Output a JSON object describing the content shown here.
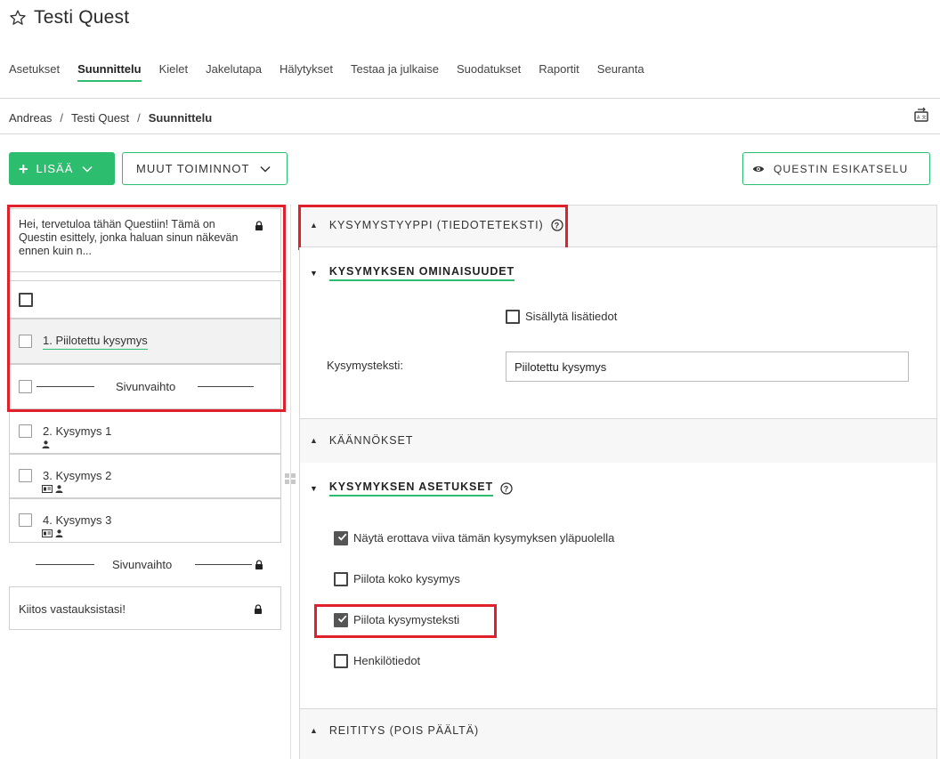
{
  "header": {
    "title": "Testi Quest",
    "star_icon": "star-outline-icon"
  },
  "nav": {
    "tabs": [
      {
        "label": "Asetukset",
        "active": false
      },
      {
        "label": "Suunnittelu",
        "active": true
      },
      {
        "label": "Kielet",
        "active": false
      },
      {
        "label": "Jakelutapa",
        "active": false
      },
      {
        "label": "Hälytykset",
        "active": false
      },
      {
        "label": "Testaa ja julkaise",
        "active": false
      },
      {
        "label": "Suodatukset",
        "active": false
      },
      {
        "label": "Raportit",
        "active": false
      },
      {
        "label": "Seuranta",
        "active": false
      }
    ]
  },
  "breadcrumb": {
    "items": [
      "Andreas",
      "Testi Quest",
      "Suunnittelu"
    ],
    "separator": "/"
  },
  "toolbar": {
    "add_label": "LISÄÄ",
    "more_label": "MUUT TOIMINNOT",
    "preview_label": "QUESTIN ESIKATSELU"
  },
  "question_list": {
    "intro_text": "Hei, tervetuloa tähän Questiin! Tämä on Questin esittely, jonka haluan sinun näkevän ennen kuin n...",
    "questions": [
      {
        "label": "1.  Piilotettu kysymys",
        "selected": true
      },
      {
        "label": "2.  Kysymys 1"
      },
      {
        "label": "3.  Kysymys 2"
      },
      {
        "label": "4.  Kysymys 3"
      }
    ],
    "page_break_label": "Sivunvaihto",
    "page_break_label_2": "Sivunvaihto",
    "outro_text": "Kiitos vastauksistasi!"
  },
  "panel": {
    "question_type": "KYSYMYSTYYPPI (TIEDOTETEKSTI)",
    "properties_header": "KYSYMYKSEN OMINAISUUDET",
    "include_extra_label": "Sisällytä lisätiedot",
    "include_extra_checked": false,
    "question_text_label": "Kysymysteksti:",
    "question_text_value": "Piilotettu kysymys",
    "translations_header": "KÄÄNNÖKSET",
    "settings_header": "KYSYMYKSEN ASETUKSET",
    "settings": [
      {
        "label": "Näytä erottava viiva tämän kysymyksen yläpuolella",
        "checked": true
      },
      {
        "label": "Piilota koko kysymys",
        "checked": false
      },
      {
        "label": "Piilota kysymysteksti",
        "checked": true
      },
      {
        "label": "Henkilötiedot",
        "checked": false
      }
    ],
    "routing_header": "REITITYS (POIS PÄÄLTÄ)"
  },
  "colors": {
    "accent": "#2dbd6e",
    "highlight": "#e0202a",
    "selected_row": "#f2f2f2",
    "section_bg": "#f7f7f7"
  }
}
